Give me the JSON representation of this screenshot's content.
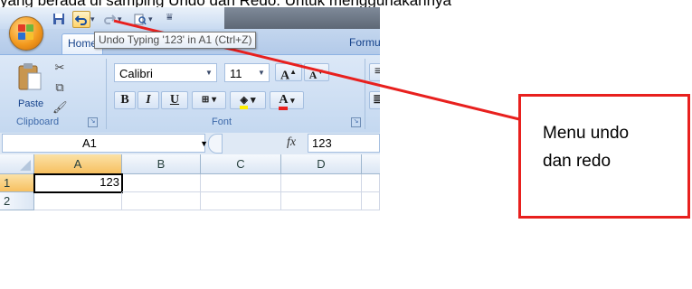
{
  "doc_text": "yang berada di samping Undo dan Redo. Untuk menggunakannya",
  "tabs": {
    "home": "Home",
    "formulas": "Formul"
  },
  "tooltip": "Undo Typing '123' in A1 (Ctrl+Z)",
  "ribbon": {
    "paste_label": "Paste",
    "clipboard_label": "Clipboard",
    "font_label": "Font",
    "font_name": "Calibri",
    "font_size": "11",
    "bold": "B",
    "italic": "I",
    "underline": "U",
    "grow_font": "A",
    "shrink_font": "A",
    "font_color_letter": "A"
  },
  "formula_bar": {
    "name_box": "A1",
    "fx": "fx",
    "value": "123"
  },
  "grid": {
    "columns": [
      "A",
      "B",
      "C",
      "D"
    ],
    "rows": [
      "1",
      "2"
    ],
    "cells": {
      "A1": "123"
    }
  },
  "annotation": {
    "text_line1": "Menu undo",
    "text_line2": "dan redo"
  },
  "colors": {
    "annotation_red": "#e8201e",
    "ribbon_blue": "#c4d8f0",
    "selected_header": "#f7c060"
  },
  "icons": [
    "office-button-icon",
    "save-icon",
    "undo-icon",
    "redo-icon",
    "print-preview-icon",
    "customize-qat-icon",
    "cut-icon",
    "copy-icon",
    "format-painter-icon",
    "borders-icon",
    "fill-color-icon",
    "dialog-launcher-icon",
    "insert-function-icon"
  ]
}
